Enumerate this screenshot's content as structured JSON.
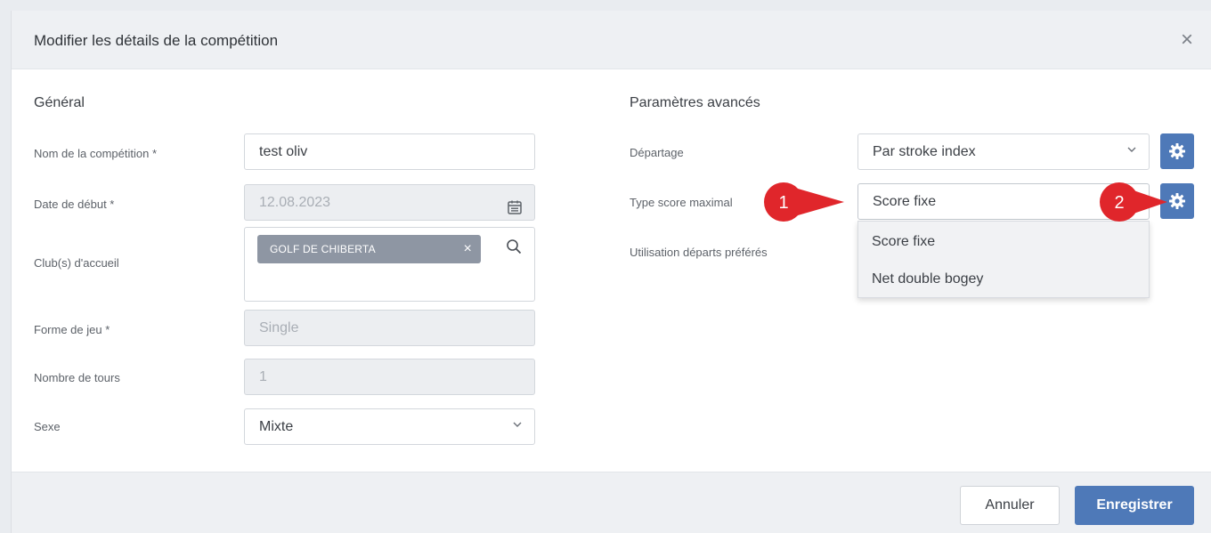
{
  "dialog": {
    "title": "Modifier les détails de la compétition",
    "close_glyph": "×"
  },
  "general": {
    "section_title": "Général",
    "fields": {
      "competition_name": {
        "label": "Nom de la compétition *",
        "value": "test oliv"
      },
      "start_date": {
        "label": "Date de début *",
        "value": "12.08.2023",
        "icon": "calendar-icon"
      },
      "host_club": {
        "label": "Club(s) d'accueil",
        "chip": "GOLF DE CHIBERTA",
        "chip_remove": "×",
        "icon": "search-icon"
      },
      "game_form": {
        "label": "Forme de jeu *",
        "value": "Single"
      },
      "rounds": {
        "label": "Nombre de tours",
        "value": "1"
      },
      "gender": {
        "label": "Sexe",
        "value": "Mixte"
      }
    }
  },
  "advanced": {
    "section_title": "Paramètres avancés",
    "fields": {
      "tiebreak": {
        "label": "Départage",
        "value": "Par stroke index"
      },
      "max_score_type": {
        "label": "Type score maximal",
        "value": "Score fixe"
      },
      "preferred_tees": {
        "label": "Utilisation départs préférés"
      }
    },
    "dropdown_options": [
      "Score fixe",
      "Net double bogey"
    ]
  },
  "annotations": {
    "badge_1": "1",
    "badge_2": "2",
    "color": "#e0262b"
  },
  "footer": {
    "cancel_label": "Annuler",
    "save_label": "Enregistrer"
  },
  "colors": {
    "accent": "#4e79b8",
    "chip": "#8e96a3",
    "header_bg": "#eef0f3"
  }
}
